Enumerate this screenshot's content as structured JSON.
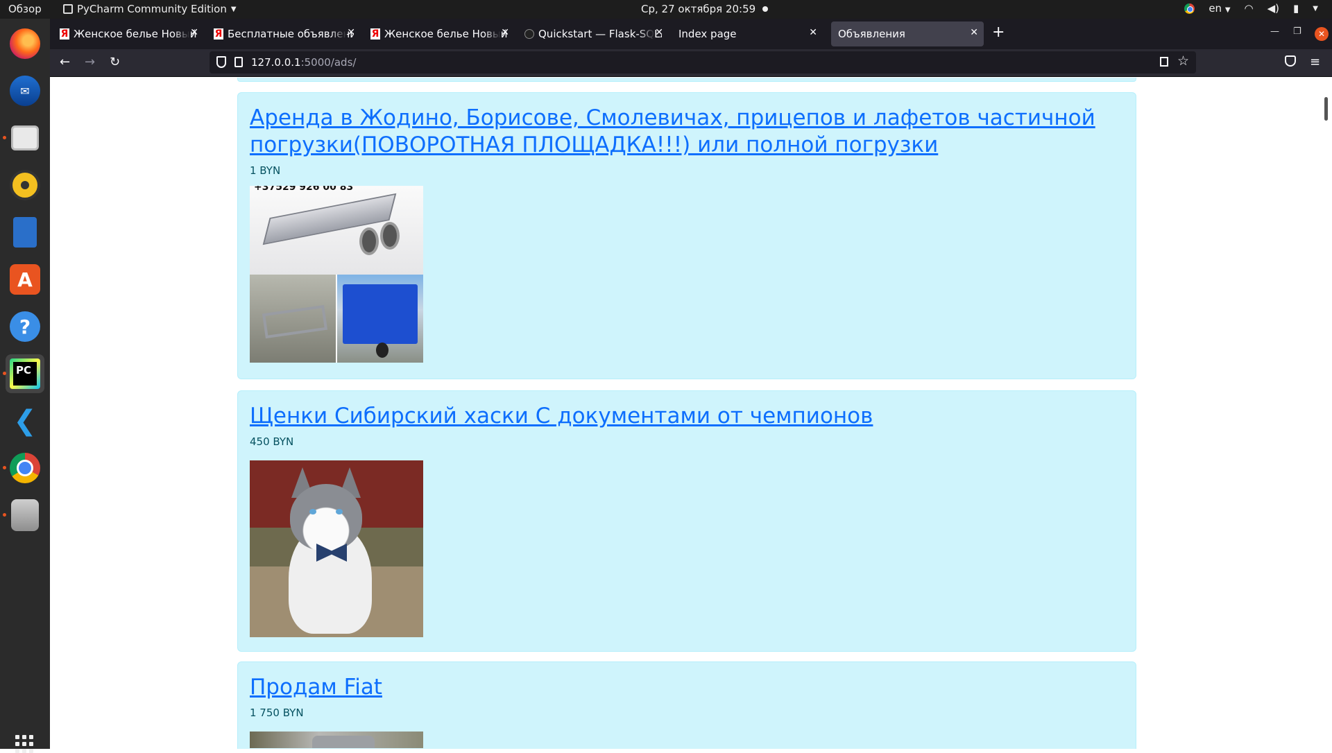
{
  "system_bar": {
    "overview": "Обзор",
    "app_menu": "PyCharm Community Edition",
    "clock": "Ср, 27 октября  20:59",
    "language": "en"
  },
  "dock": {
    "items": [
      "firefox",
      "thunderbird",
      "files",
      "rhythmbox",
      "libreoffice-writer",
      "software-center",
      "help",
      "pycharm",
      "vscode",
      "chrome",
      "database"
    ]
  },
  "browser": {
    "tabs": [
      {
        "title": "Женское белье Новый ж",
        "favicon": "yandex-favicon"
      },
      {
        "title": "Бесплатные объявлени",
        "favicon": "yandex-favicon"
      },
      {
        "title": "Женское белье Новый ж",
        "favicon": "yandex-favicon"
      },
      {
        "title": "Quickstart — Flask-SQLA",
        "favicon": "github-favicon"
      },
      {
        "title": "Index page",
        "favicon": "none"
      },
      {
        "title": "Объявления",
        "favicon": "none",
        "selected": true
      }
    ],
    "url_host": "127.0.0.1",
    "url_path": ":5000/ads/"
  },
  "ads": [
    {
      "title": "Аренда в Жодино, Борисове, Смолевичах, прицепов и лафетов частичной погрузки(ПОВОРОТНАЯ ПЛОЩАДКА!!!) или полной погрузки",
      "price": "1 BYN",
      "photo_text": "+37529 926 00 83"
    },
    {
      "title": "Щенки Сибирский хаски С документами от чемпионов",
      "price": "450 BYN"
    },
    {
      "title": "Продам Fiat",
      "price": "1 750 BYN"
    }
  ]
}
